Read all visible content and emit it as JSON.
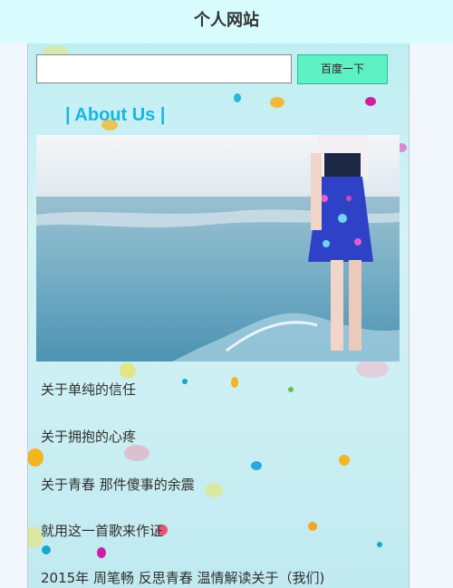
{
  "header": {
    "title": "个人网站"
  },
  "search": {
    "placeholder": "",
    "value": "",
    "button_label": "百度一下"
  },
  "about": {
    "heading": "| About Us |"
  },
  "articles": [
    "关于单纯的信任",
    "关于拥抱的心疼",
    "关于青春 那件傻事的余震",
    "就用这一首歌来作证",
    "2015年 周笔畅 反思青春 温情解读关于（我们)"
  ],
  "colors": {
    "header_bg": "#d8fbfd",
    "accent": "#15b6e6",
    "button_bg": "#5df1c3"
  }
}
